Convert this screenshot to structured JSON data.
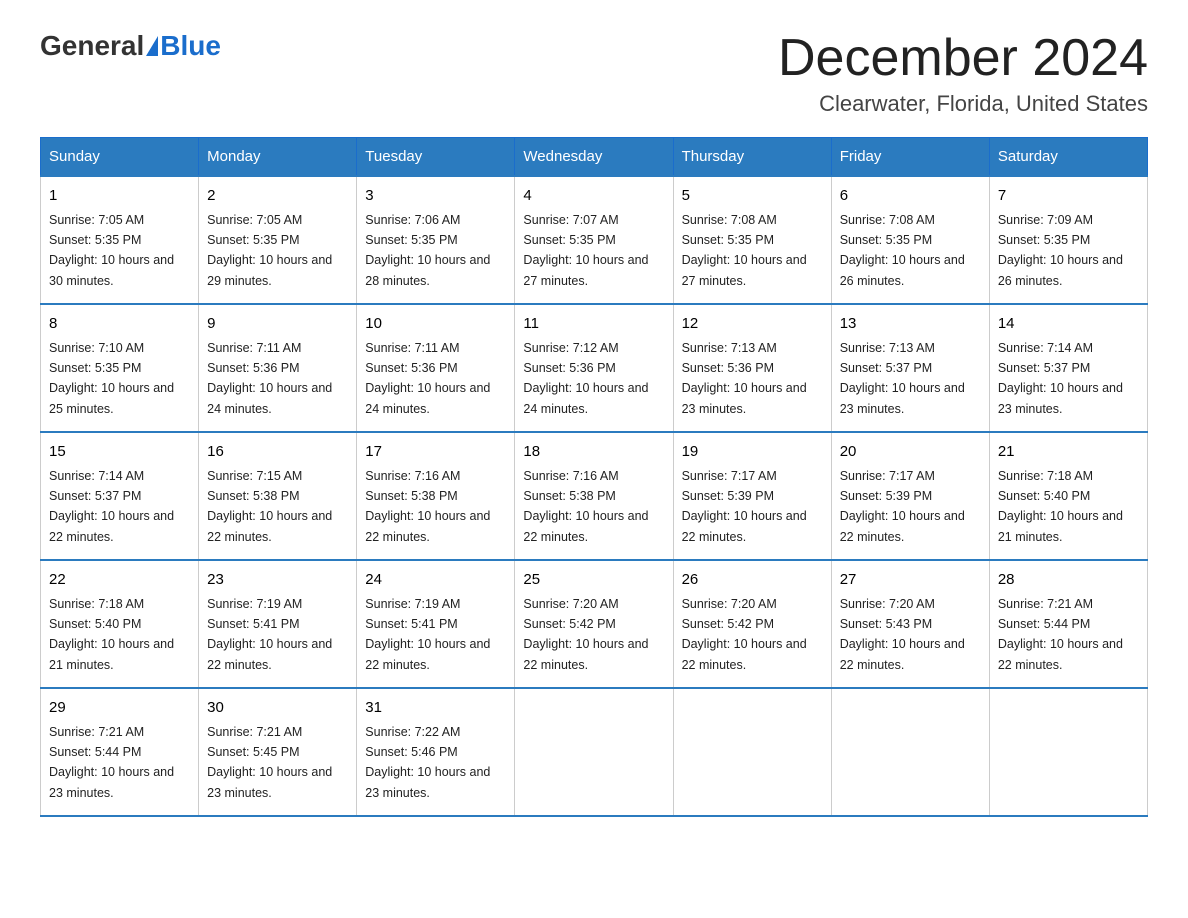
{
  "logo": {
    "general": "General",
    "blue": "Blue"
  },
  "header": {
    "month": "December 2024",
    "location": "Clearwater, Florida, United States"
  },
  "weekdays": [
    "Sunday",
    "Monday",
    "Tuesday",
    "Wednesday",
    "Thursday",
    "Friday",
    "Saturday"
  ],
  "weeks": [
    [
      {
        "num": "1",
        "sunrise": "7:05 AM",
        "sunset": "5:35 PM",
        "daylight": "10 hours and 30 minutes."
      },
      {
        "num": "2",
        "sunrise": "7:05 AM",
        "sunset": "5:35 PM",
        "daylight": "10 hours and 29 minutes."
      },
      {
        "num": "3",
        "sunrise": "7:06 AM",
        "sunset": "5:35 PM",
        "daylight": "10 hours and 28 minutes."
      },
      {
        "num": "4",
        "sunrise": "7:07 AM",
        "sunset": "5:35 PM",
        "daylight": "10 hours and 27 minutes."
      },
      {
        "num": "5",
        "sunrise": "7:08 AM",
        "sunset": "5:35 PM",
        "daylight": "10 hours and 27 minutes."
      },
      {
        "num": "6",
        "sunrise": "7:08 AM",
        "sunset": "5:35 PM",
        "daylight": "10 hours and 26 minutes."
      },
      {
        "num": "7",
        "sunrise": "7:09 AM",
        "sunset": "5:35 PM",
        "daylight": "10 hours and 26 minutes."
      }
    ],
    [
      {
        "num": "8",
        "sunrise": "7:10 AM",
        "sunset": "5:35 PM",
        "daylight": "10 hours and 25 minutes."
      },
      {
        "num": "9",
        "sunrise": "7:11 AM",
        "sunset": "5:36 PM",
        "daylight": "10 hours and 24 minutes."
      },
      {
        "num": "10",
        "sunrise": "7:11 AM",
        "sunset": "5:36 PM",
        "daylight": "10 hours and 24 minutes."
      },
      {
        "num": "11",
        "sunrise": "7:12 AM",
        "sunset": "5:36 PM",
        "daylight": "10 hours and 24 minutes."
      },
      {
        "num": "12",
        "sunrise": "7:13 AM",
        "sunset": "5:36 PM",
        "daylight": "10 hours and 23 minutes."
      },
      {
        "num": "13",
        "sunrise": "7:13 AM",
        "sunset": "5:37 PM",
        "daylight": "10 hours and 23 minutes."
      },
      {
        "num": "14",
        "sunrise": "7:14 AM",
        "sunset": "5:37 PM",
        "daylight": "10 hours and 23 minutes."
      }
    ],
    [
      {
        "num": "15",
        "sunrise": "7:14 AM",
        "sunset": "5:37 PM",
        "daylight": "10 hours and 22 minutes."
      },
      {
        "num": "16",
        "sunrise": "7:15 AM",
        "sunset": "5:38 PM",
        "daylight": "10 hours and 22 minutes."
      },
      {
        "num": "17",
        "sunrise": "7:16 AM",
        "sunset": "5:38 PM",
        "daylight": "10 hours and 22 minutes."
      },
      {
        "num": "18",
        "sunrise": "7:16 AM",
        "sunset": "5:38 PM",
        "daylight": "10 hours and 22 minutes."
      },
      {
        "num": "19",
        "sunrise": "7:17 AM",
        "sunset": "5:39 PM",
        "daylight": "10 hours and 22 minutes."
      },
      {
        "num": "20",
        "sunrise": "7:17 AM",
        "sunset": "5:39 PM",
        "daylight": "10 hours and 22 minutes."
      },
      {
        "num": "21",
        "sunrise": "7:18 AM",
        "sunset": "5:40 PM",
        "daylight": "10 hours and 21 minutes."
      }
    ],
    [
      {
        "num": "22",
        "sunrise": "7:18 AM",
        "sunset": "5:40 PM",
        "daylight": "10 hours and 21 minutes."
      },
      {
        "num": "23",
        "sunrise": "7:19 AM",
        "sunset": "5:41 PM",
        "daylight": "10 hours and 22 minutes."
      },
      {
        "num": "24",
        "sunrise": "7:19 AM",
        "sunset": "5:41 PM",
        "daylight": "10 hours and 22 minutes."
      },
      {
        "num": "25",
        "sunrise": "7:20 AM",
        "sunset": "5:42 PM",
        "daylight": "10 hours and 22 minutes."
      },
      {
        "num": "26",
        "sunrise": "7:20 AM",
        "sunset": "5:42 PM",
        "daylight": "10 hours and 22 minutes."
      },
      {
        "num": "27",
        "sunrise": "7:20 AM",
        "sunset": "5:43 PM",
        "daylight": "10 hours and 22 minutes."
      },
      {
        "num": "28",
        "sunrise": "7:21 AM",
        "sunset": "5:44 PM",
        "daylight": "10 hours and 22 minutes."
      }
    ],
    [
      {
        "num": "29",
        "sunrise": "7:21 AM",
        "sunset": "5:44 PM",
        "daylight": "10 hours and 23 minutes."
      },
      {
        "num": "30",
        "sunrise": "7:21 AM",
        "sunset": "5:45 PM",
        "daylight": "10 hours and 23 minutes."
      },
      {
        "num": "31",
        "sunrise": "7:22 AM",
        "sunset": "5:46 PM",
        "daylight": "10 hours and 23 minutes."
      },
      null,
      null,
      null,
      null
    ]
  ]
}
